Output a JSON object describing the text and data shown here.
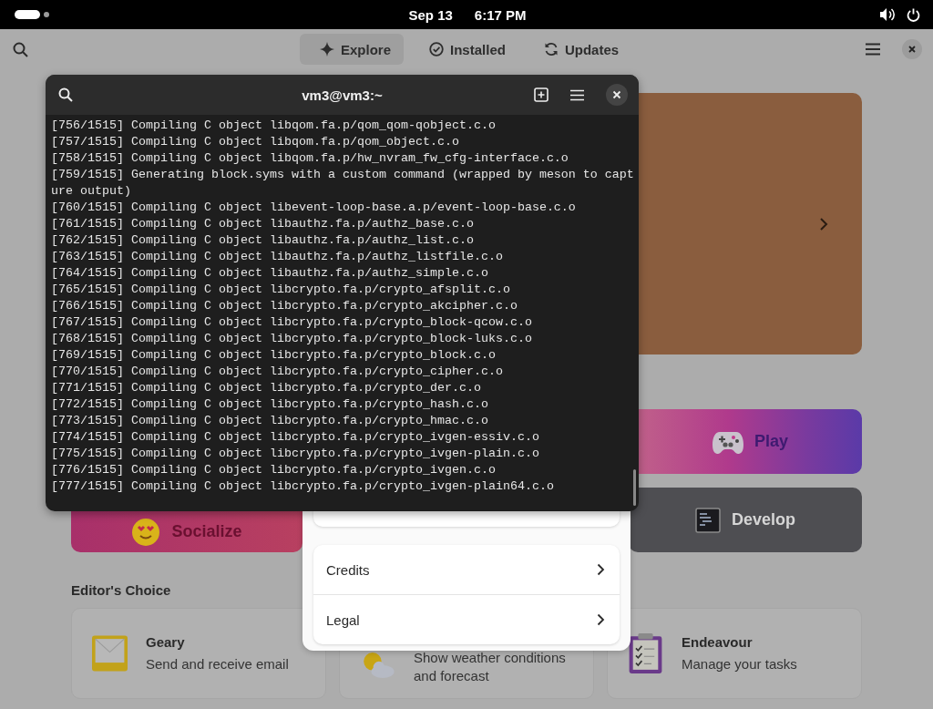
{
  "top_bar": {
    "date": "Sep 13",
    "time": "6:17 PM"
  },
  "header": {
    "tabs": [
      {
        "label": "Explore",
        "selected": true
      },
      {
        "label": "Installed",
        "selected": false
      },
      {
        "label": "Updates",
        "selected": false
      }
    ]
  },
  "categories": [
    {
      "label": "Play",
      "kind": "play"
    },
    {
      "label": "Socialize",
      "kind": "socialize"
    },
    {
      "label": "Develop",
      "kind": "develop"
    }
  ],
  "editors_choice": {
    "title": "Editor's Choice",
    "apps": [
      {
        "name": "Geary",
        "description": "Send and receive email"
      },
      {
        "description": "Show weather conditions and forecast"
      },
      {
        "name": "Endeavour",
        "description": "Manage your tasks"
      }
    ]
  },
  "about_dialog": {
    "rows": [
      {
        "label": "Credits"
      },
      {
        "label": "Legal"
      }
    ]
  },
  "terminal": {
    "title": "vm3@vm3:~",
    "lines": [
      "[756/1515] Compiling C object libqom.fa.p/qom_qom-qobject.c.o",
      "[757/1515] Compiling C object libqom.fa.p/qom_object.c.o",
      "[758/1515] Compiling C object libqom.fa.p/hw_nvram_fw_cfg-interface.c.o",
      "[759/1515] Generating block.syms with a custom command (wrapped by meson to capture output)",
      "[760/1515] Compiling C object libevent-loop-base.a.p/event-loop-base.c.o",
      "[761/1515] Compiling C object libauthz.fa.p/authz_base.c.o",
      "[762/1515] Compiling C object libauthz.fa.p/authz_list.c.o",
      "[763/1515] Compiling C object libauthz.fa.p/authz_listfile.c.o",
      "[764/1515] Compiling C object libauthz.fa.p/authz_simple.c.o",
      "[765/1515] Compiling C object libcrypto.fa.p/crypto_afsplit.c.o",
      "[766/1515] Compiling C object libcrypto.fa.p/crypto_akcipher.c.o",
      "[767/1515] Compiling C object libcrypto.fa.p/crypto_block-qcow.c.o",
      "[768/1515] Compiling C object libcrypto.fa.p/crypto_block-luks.c.o",
      "[769/1515] Compiling C object libcrypto.fa.p/crypto_block.c.o",
      "[770/1515] Compiling C object libcrypto.fa.p/crypto_cipher.c.o",
      "[771/1515] Compiling C object libcrypto.fa.p/crypto_der.c.o",
      "[772/1515] Compiling C object libcrypto.fa.p/crypto_hash.c.o",
      "[773/1515] Compiling C object libcrypto.fa.p/crypto_hmac.c.o",
      "[774/1515] Compiling C object libcrypto.fa.p/crypto_ivgen-essiv.c.o",
      "[775/1515] Compiling C object libcrypto.fa.p/crypto_ivgen-plain.c.o",
      "[776/1515] Compiling C object libcrypto.fa.p/crypto_ivgen.c.o",
      "[777/1515] Compiling C object libcrypto.fa.p/crypto_ivgen-plain64.c.o"
    ]
  }
}
